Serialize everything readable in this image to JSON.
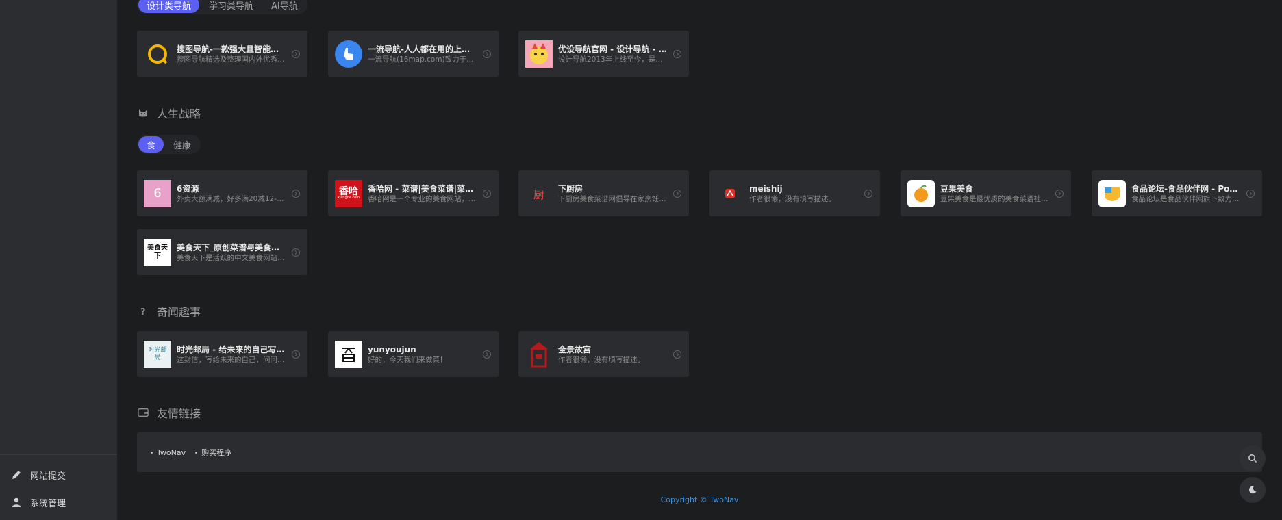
{
  "sidebar": {
    "items": [
      {
        "label": "网站提交",
        "icon": "pencil-icon"
      },
      {
        "label": "系统管理",
        "icon": "user-icon"
      }
    ]
  },
  "nav_tabs": [
    {
      "label": "设计类导航",
      "active": true
    },
    {
      "label": "学习类导航",
      "active": false
    },
    {
      "label": "AI导航",
      "active": false
    }
  ],
  "nav_cards": [
    {
      "title": "搜图导航-一款强大且智能的...",
      "desc": "搜图导航精选及整理国内外优秀的..."
    },
    {
      "title": "一流导航-人人都在用的上网...",
      "desc": "一流导航(16map.com)致力于打造..."
    },
    {
      "title": "优设导航官网 - 设计导航 - 国...",
      "desc": "设计导航2013年上线至今，是优设..."
    }
  ],
  "life": {
    "title": "人生战略",
    "tabs": [
      {
        "label": "食",
        "active": true
      },
      {
        "label": "健康",
        "active": false
      }
    ],
    "cards": [
      {
        "title": "6资源",
        "desc": "外卖大额满减，好多满20减12-15...",
        "logo_text": "6"
      },
      {
        "title": "香哈网 - 菜谱|美食菜谱|菜谱...",
        "desc": "香哈网是一个专业的美食网站，提...",
        "logo_text": "香哈",
        "logo_sub": "xiangha.com"
      },
      {
        "title": "下厨房",
        "desc": "下厨房美食菜谱网倡导在家烹饪、...",
        "logo_text": "厨"
      },
      {
        "title": "meishij",
        "desc": "作者很懒，没有填写描述。",
        "logo_text": ""
      },
      {
        "title": "豆果美食",
        "desc": "豆果美食是最优质的美食菜谱社区...",
        "logo_text": ""
      },
      {
        "title": "食品论坛-食品伙伴网 - Pow...",
        "desc": "食品论坛是食品伙伴网旗下致力于...",
        "logo_text": ""
      },
      {
        "title": "美食天下_原创菜谱与美食生...",
        "desc": "美食天下是活跃的中文美食网站与...",
        "logo_text": "美食天下"
      }
    ]
  },
  "stories": {
    "title": "奇闻趣事",
    "cards": [
      {
        "title": "时光邮局 - 给未来的自己写一...",
        "desc": "这封信，写给未来的自己，问问当...",
        "logo_text": "时光邮局"
      },
      {
        "title": "yunyoujun",
        "desc": "好的，今天我们来做菜！",
        "logo_text": ""
      },
      {
        "title": "全景故宫",
        "desc": "作者很懒，没有填写描述。",
        "logo_text": ""
      }
    ]
  },
  "friend_links": {
    "title": "友情链接",
    "items": [
      "TwoNav",
      "购买程序"
    ]
  },
  "footer": {
    "text": "Copyright © TwoNav"
  },
  "colors": {
    "accent": "#5b5ff2",
    "card_bg": "#2a2c2f",
    "sidebar_bg": "#2b2d30",
    "page_bg": "#1b1d1f",
    "footer_link": "#3b8fd9"
  }
}
